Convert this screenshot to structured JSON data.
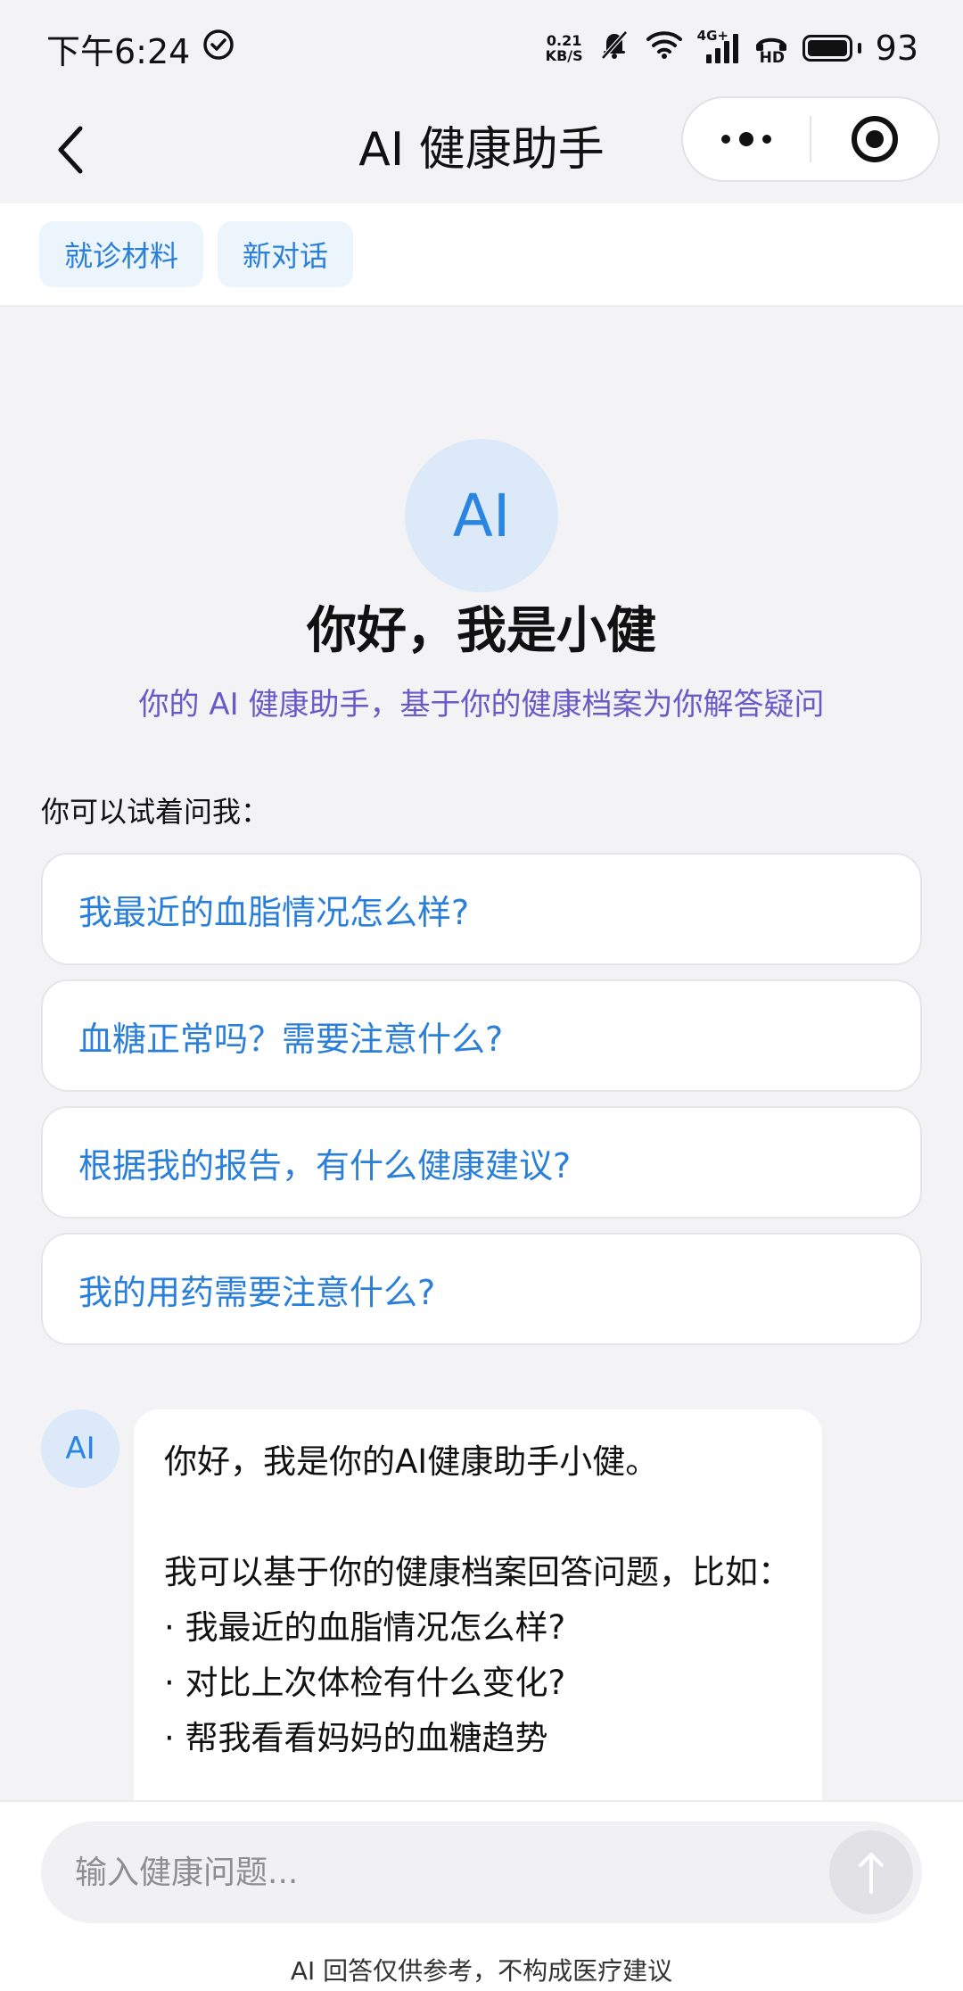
{
  "status_bar": {
    "time": "下午6:24",
    "net_speed_value": "0.21",
    "net_speed_unit": "KB/S",
    "network_type": "4G+",
    "hd_label": "HD",
    "battery": "93",
    "icons": [
      "check-circle-icon",
      "bell-muted-icon",
      "wifi-icon",
      "cellular-signal-icon",
      "hd-call-icon",
      "battery-icon"
    ]
  },
  "nav": {
    "title": "AI 健康助手",
    "back_icon": "chevron-left-icon",
    "more_icon": "more-dots-icon",
    "close_icon": "target-circle-icon"
  },
  "actions": {
    "materials": "就诊材料",
    "new_chat": "新对话"
  },
  "welcome": {
    "avatar_text": "AI",
    "greeting": "你好，我是小健",
    "subtitle": "你的 AI 健康助手，基于你的健康档案为你解答疑问",
    "try_label": "你可以试着问我："
  },
  "suggestions": [
    "我最近的血脂情况怎么样?",
    "血糖正常吗？需要注意什么?",
    "根据我的报告，有什么健康建议?",
    "我的用药需要注意什么?"
  ],
  "message": {
    "avatar_text": "AI",
    "line1": "你好，我是你的AI健康助手小健。",
    "line2": "我可以基于你的健康档案回答问题，比如：",
    "bullets": [
      "· 我最近的血脂情况怎么样?",
      "· 对比上次体检有什么变化?",
      "· 帮我看看妈妈的血糖趋势"
    ]
  },
  "composer": {
    "placeholder": "输入健康问题...",
    "send_icon": "arrow-up-icon",
    "disclaimer": "AI 回答仅供参考，不构成医疗建议"
  },
  "colors": {
    "accent": "#2a7fd8",
    "subtitle": "#6a5ac8",
    "chip_bg": "#ecf4fc",
    "avatar_bg": "#dce9f8",
    "page_bg": "#f3f3f5"
  }
}
